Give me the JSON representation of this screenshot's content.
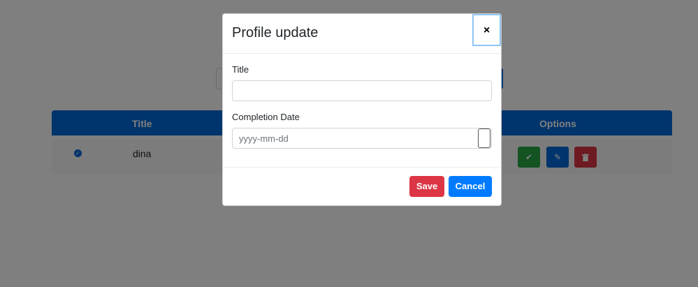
{
  "modal": {
    "title": "Profile update",
    "close_glyph": "×",
    "title_label": "Title",
    "title_value": "",
    "date_label": "Completion Date",
    "date_placeholder": "yyyy-mm-dd",
    "save_label": "Save",
    "cancel_label": "Cancel"
  },
  "table": {
    "headers": {
      "title": "Title",
      "options": "Options"
    },
    "rows": [
      {
        "completed": true,
        "title": "dina"
      }
    ]
  },
  "icons": {
    "completed": "check-circle-icon",
    "done_button": "check-icon",
    "edit_button": "pencil-icon",
    "delete_button": "trash-icon"
  },
  "colors": {
    "primary": "#0069d9",
    "success": "#28a745",
    "danger": "#dc3545",
    "cancel": "#007bff",
    "backdrop": "rgba(0,0,0,0.5)"
  }
}
